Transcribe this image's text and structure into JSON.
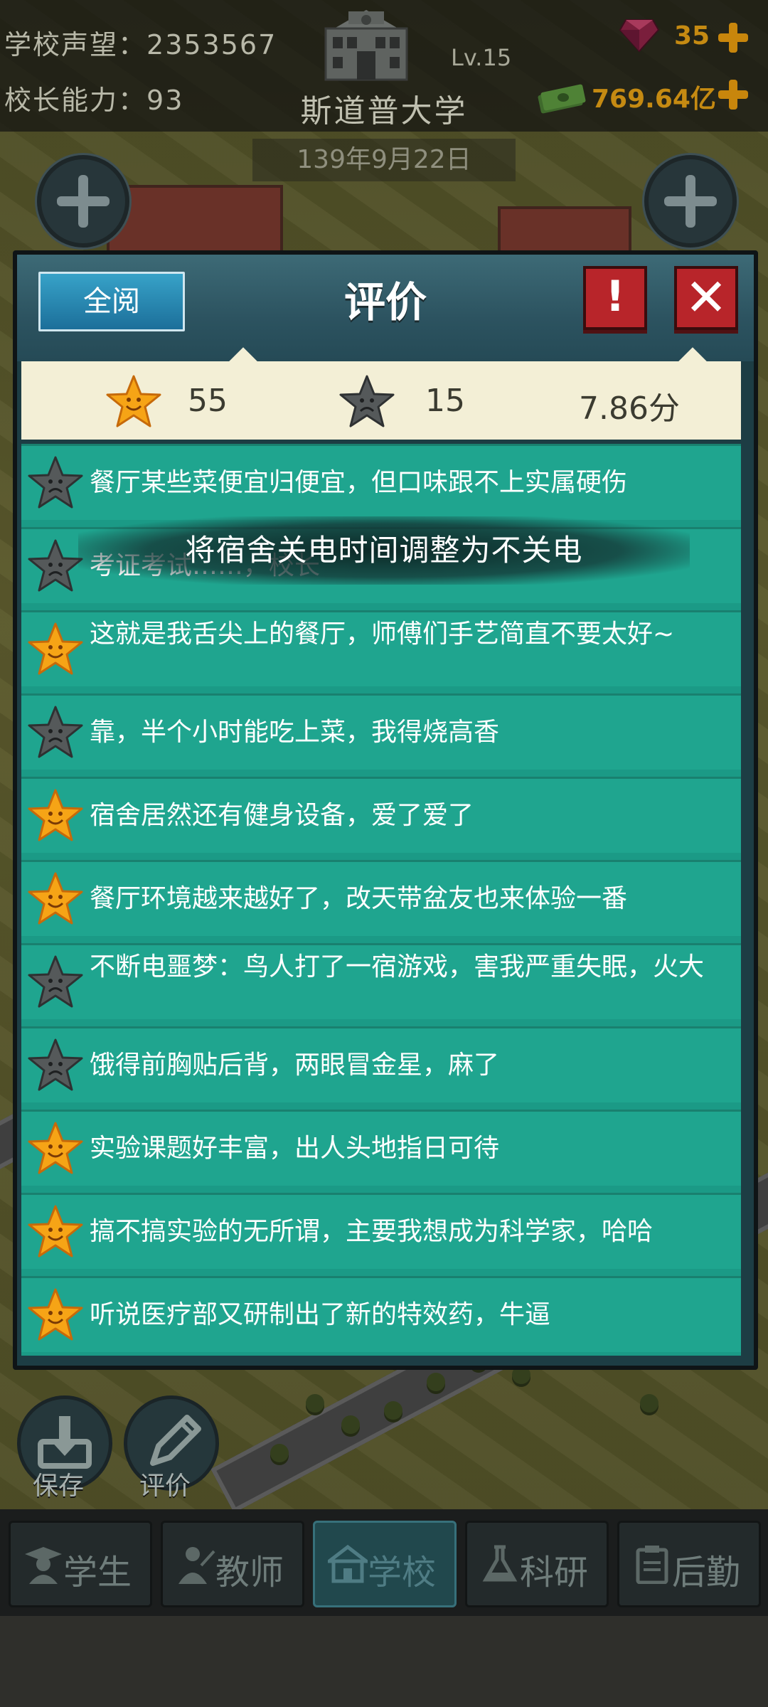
{
  "hud": {
    "reputation_label": "学校声望：",
    "reputation_value": "2353567",
    "ability_label": "校长能力：",
    "ability_value": "93",
    "level": "Lv.15",
    "school_name": "斯道普大学",
    "gems": "35",
    "money": "769.64亿",
    "date": "139年9月22日"
  },
  "dialog": {
    "read_all_label": "全阅",
    "title": "评价",
    "alert_label": "!",
    "close_label": "✕",
    "stats": {
      "good_count": "55",
      "bad_count": "15",
      "score": "7.86分"
    },
    "toast": "将宿舍关电时间调整为不关电",
    "reviews": [
      {
        "sentiment": "bad",
        "text": "餐厅某些菜便宜归便宜，但口味跟不上实属硬伤"
      },
      {
        "sentiment": "bad",
        "text": "考证考试……，校长"
      },
      {
        "sentiment": "good",
        "text": "这就是我舌尖上的餐厅，师傅们手艺简直不要太好~"
      },
      {
        "sentiment": "bad",
        "text": "靠，半个小时能吃上菜，我得烧高香"
      },
      {
        "sentiment": "good",
        "text": "宿舍居然还有健身设备，爱了爱了"
      },
      {
        "sentiment": "good",
        "text": "餐厅环境越来越好了，改天带盆友也来体验一番"
      },
      {
        "sentiment": "bad",
        "text": "不断电噩梦：鸟人打了一宿游戏，害我严重失眠，火大"
      },
      {
        "sentiment": "bad",
        "text": "饿得前胸贴后背，两眼冒金星，麻了"
      },
      {
        "sentiment": "good",
        "text": "实验课题好丰富，出人头地指日可待"
      },
      {
        "sentiment": "good",
        "text": "搞不搞实验的无所谓，主要我想成为科学家，哈哈"
      },
      {
        "sentiment": "good",
        "text": "听说医疗部又研制出了新的特效药，牛逼"
      }
    ]
  },
  "actions": {
    "save_label": "保存",
    "review_label": "评价"
  },
  "tabs": [
    {
      "label": "学生",
      "icon": "student-icon"
    },
    {
      "label": "教师",
      "icon": "teacher-icon"
    },
    {
      "label": "学校",
      "icon": "school-icon"
    },
    {
      "label": "科研",
      "icon": "flask-icon"
    },
    {
      "label": "后勤",
      "icon": "clipboard-icon"
    }
  ],
  "colors": {
    "list_bg": "#1fa58f",
    "good_star": "#f6a416",
    "bad_star": "#55595a",
    "accent_gold": "#c58a12",
    "close_red": "#b8252a"
  }
}
